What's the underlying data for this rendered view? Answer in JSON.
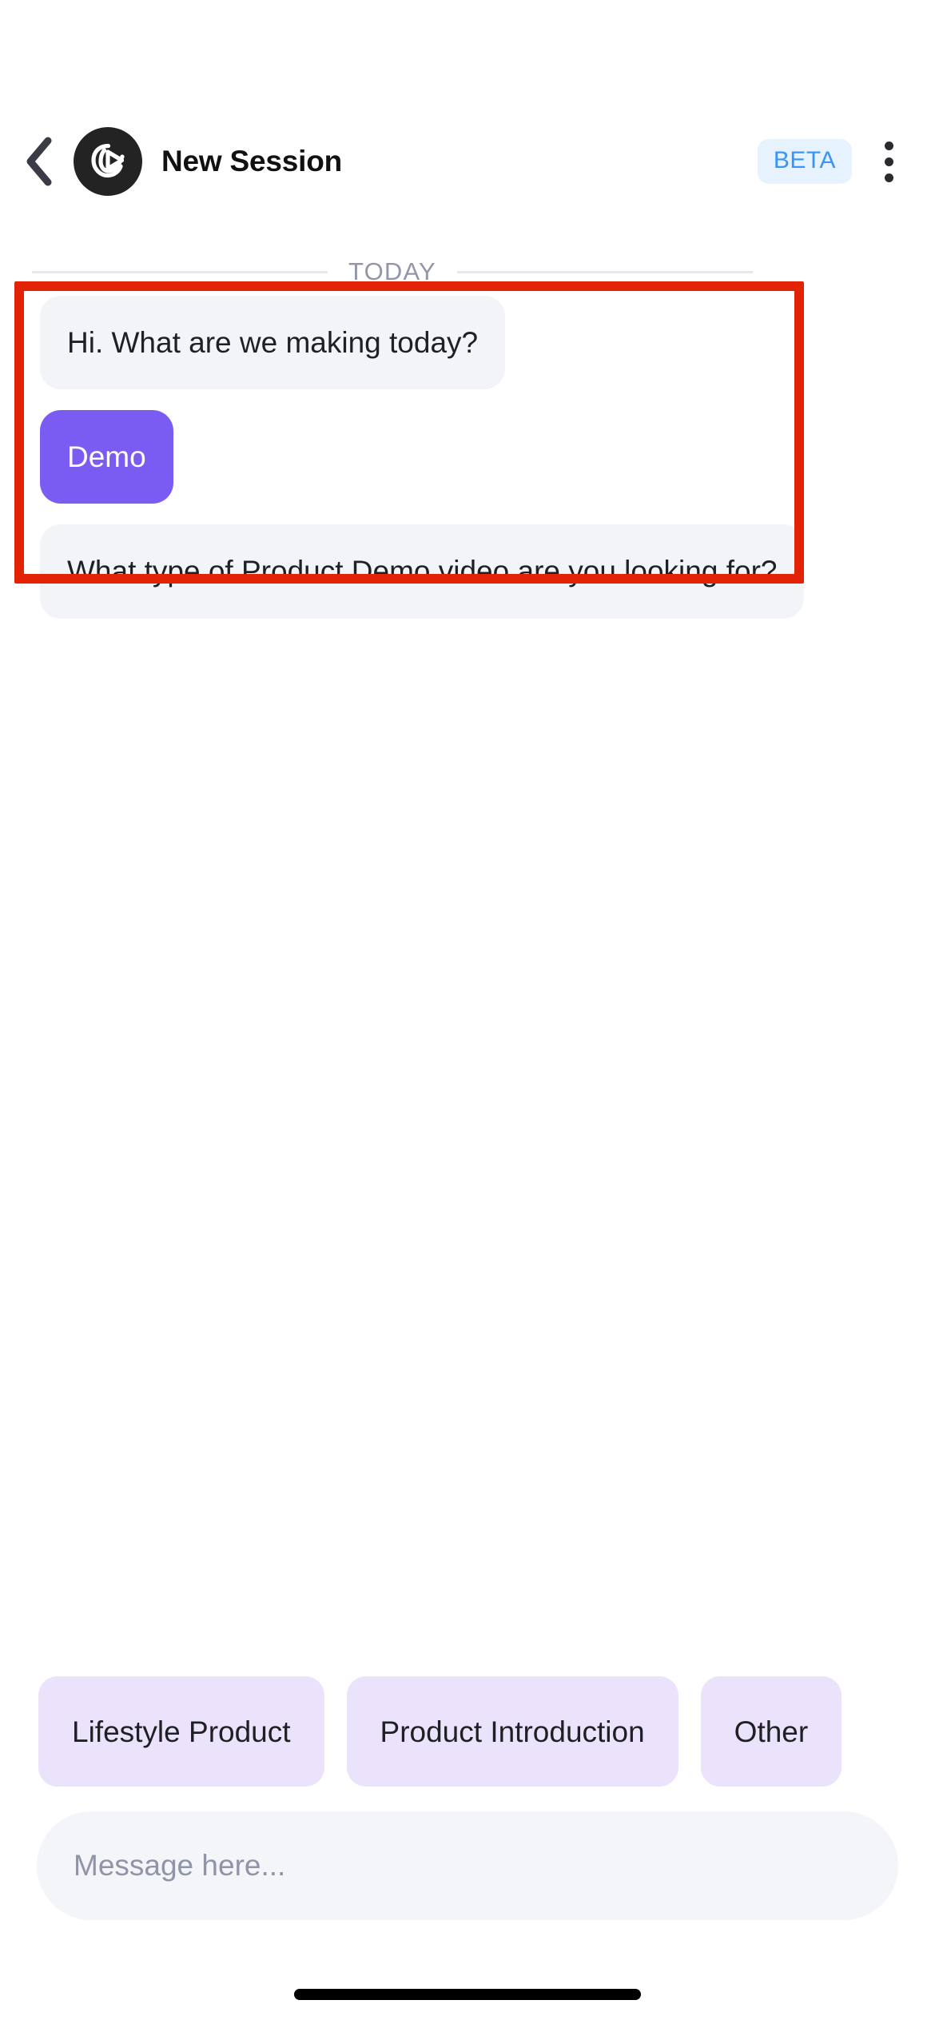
{
  "app": {
    "logo_icon": "loop-play-logo-icon",
    "brand_dark": "#232323"
  },
  "header": {
    "back_icon": "chevron-left-icon",
    "title": "New Session",
    "badge": {
      "label": "BETA",
      "text_color": "#3B95F6",
      "background_color": "#E6F2FE"
    },
    "overflow_icon": "more-vertical-icon"
  },
  "divider": {
    "label": "TODAY",
    "text_color": "#9296AA",
    "line_color": "#E6E6F0"
  },
  "conversation": {
    "messages": [
      {
        "role": "assistant",
        "text": "Hi. What are we making today?",
        "background_color": "#F3F4F8",
        "text_color": "#1F2024"
      },
      {
        "role": "user",
        "text": "Demo",
        "background_color": "#7B5CF2",
        "text_color": "#FFFFFF"
      },
      {
        "role": "assistant",
        "text": "What type of Product Demo video are you looking for?",
        "background_color": "#F3F4F8",
        "text_color": "#1F2024"
      }
    ]
  },
  "annotation": {
    "color": "#E32306",
    "encloses": "first-two-messages"
  },
  "suggestions": {
    "chips": [
      {
        "label": "Lifestyle Product"
      },
      {
        "label": "Product Introduction"
      },
      {
        "label": "Other"
      }
    ],
    "background_color": "#EAE3FB",
    "text_color": "#1F2024"
  },
  "composer": {
    "placeholder": "Message here...",
    "value": "",
    "background_color": "#F4F5F9",
    "placeholder_color": "#9094A8"
  },
  "system": {
    "home_indicator": "home-indicator-bar"
  }
}
